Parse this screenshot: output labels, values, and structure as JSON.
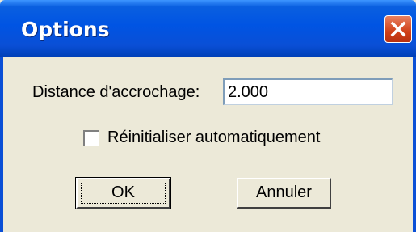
{
  "window": {
    "title": "Options",
    "close_icon": "close-icon"
  },
  "form": {
    "distance_label": "Distance d'accrochage:",
    "distance_value": "2.000",
    "auto_reset_label": "Réinitialiser automatiquement",
    "auto_reset_checked": false
  },
  "buttons": {
    "ok_label": "OK",
    "cancel_label": "Annuler"
  },
  "colors": {
    "titlebar": "#0054e3",
    "dialog_bg": "#ece9d8",
    "close_button": "#d04018"
  }
}
